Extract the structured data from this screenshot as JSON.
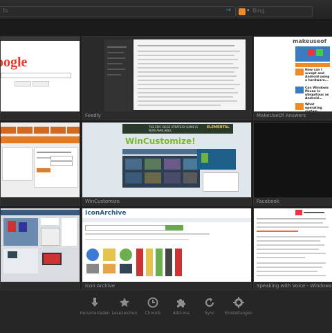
{
  "toolbar": {
    "url_text": "fo",
    "search_text": "Bing"
  },
  "tiles": [
    {
      "caption": ""
    },
    {
      "caption": "Feedly"
    },
    {
      "caption": "MakeUseOf Answers"
    },
    {
      "caption": ""
    },
    {
      "caption": "WinCustomize"
    },
    {
      "caption": "Facebook"
    },
    {
      "caption": ""
    },
    {
      "caption": "Icon Archive"
    },
    {
      "caption": "Speaking with Voice - Windows Ziga Help Ansa"
    }
  ],
  "thumb_text": {
    "google": "oogle",
    "makeuseof": "makeuseof",
    "wincustomize": "WinCustomize!",
    "iconarchive": "IconArchive",
    "stardock": "THE EPIC SIEGE STRATEGY GAME IS NOW AVAILABLE",
    "elemental": "ELEMENTAL",
    "q1": "How can I accept and Android using a hardware...",
    "q2": "Can Windows Phone Is ubiquitous as Android...",
    "q3": "What operating system ..."
  },
  "bottom": {
    "buttons": [
      {
        "label": "Herunterladen",
        "icon": "download-arrow"
      },
      {
        "label": "Lesezeichen",
        "icon": "star"
      },
      {
        "label": "Chronik",
        "icon": "clock"
      },
      {
        "label": "Add-ons",
        "icon": "puzzle"
      },
      {
        "label": "Sync",
        "icon": "sync"
      },
      {
        "label": "Einstellungen",
        "icon": "gear"
      }
    ]
  },
  "colors": {
    "accent": "#f08a24",
    "link": "#3a9ad9",
    "background": "#1b1b1b"
  }
}
